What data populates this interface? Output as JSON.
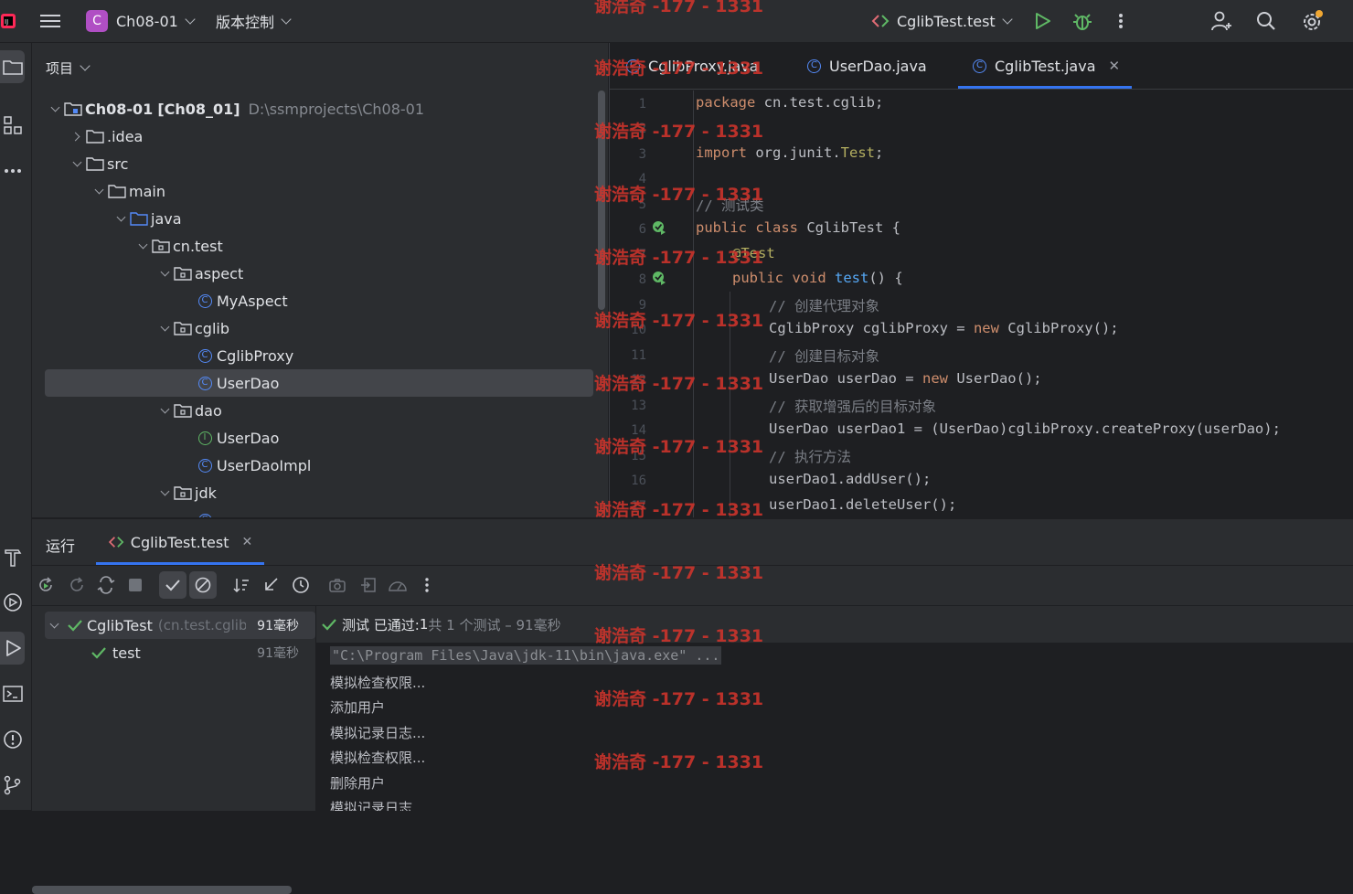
{
  "titlebar": {
    "project_badge": "C",
    "project_name": "Ch08-01",
    "vcs_label": "版本控制",
    "run_config": "CglibTest.test"
  },
  "project_panel": {
    "title": "项目",
    "tree": [
      {
        "label": "Ch08-01",
        "suffix": "[Ch08_01]",
        "path": "D:\\ssmprojects\\Ch08-01",
        "icon": "module-folder-icon"
      },
      {
        "label": ".idea",
        "icon": "folder-icon"
      },
      {
        "label": "src",
        "icon": "folder-icon"
      },
      {
        "label": "main",
        "icon": "folder-icon"
      },
      {
        "label": "java",
        "icon": "source-folder-icon"
      },
      {
        "label": "cn.test",
        "icon": "package-icon"
      },
      {
        "label": "aspect",
        "icon": "package-icon"
      },
      {
        "label": "MyAspect",
        "icon": "class-icon"
      },
      {
        "label": "cglib",
        "icon": "package-icon"
      },
      {
        "label": "CglibProxy",
        "icon": "class-icon"
      },
      {
        "label": "UserDao",
        "icon": "class-icon"
      },
      {
        "label": "dao",
        "icon": "package-icon"
      },
      {
        "label": "UserDao",
        "icon": "interface-icon"
      },
      {
        "label": "UserDaoImpl",
        "icon": "class-icon"
      },
      {
        "label": "jdk",
        "icon": "package-icon"
      }
    ]
  },
  "editor": {
    "tabs": [
      {
        "label": "CglibProxy.java"
      },
      {
        "label": "UserDao.java"
      },
      {
        "label": "CglibTest.java",
        "active": true
      }
    ],
    "line_numbers": [
      "1",
      "2",
      "3",
      "4",
      "5",
      "6",
      "7",
      "8",
      "9",
      "10",
      "11",
      "12",
      "13",
      "14",
      "15",
      "16",
      "17"
    ],
    "code": {
      "l1_kw": "package",
      "l1_rest": " cn.test.cglib;",
      "l3_kw": "import",
      "l3_rest": " org.junit.",
      "l3_ann": "Test",
      "l3_end": ";",
      "l5": "// 测试类",
      "l6_kw": "public class",
      "l6_rest": " CglibTest {",
      "l7": "@Test",
      "l8_kw": "public void",
      "l8_fn": " test",
      "l8_rest": "() {",
      "l9": "// 创建代理对象",
      "l10_a": "CglibProxy cglibProxy = ",
      "l10_kw": "new",
      "l10_b": " CglibProxy();",
      "l11": "// 创建目标对象",
      "l12_a": "UserDao userDao = ",
      "l12_kw": "new",
      "l12_b": " UserDao();",
      "l13": "// 获取增强后的目标对象",
      "l14": "UserDao userDao1 = (UserDao)cglibProxy.createProxy(userDao);",
      "l15": "// 执行方法",
      "l16": "userDao1.addUser();",
      "l17": "userDao1.deleteUser();"
    }
  },
  "run_panel": {
    "title": "运行",
    "tab_label": "CglibTest.test",
    "tree": {
      "root_label": "CglibTest",
      "root_pkg": "(cn.test.cglib",
      "root_time": "91毫秒",
      "child_label": "test",
      "child_time": "91毫秒"
    },
    "status": {
      "prefix": "测试 已通过: ",
      "count": "1",
      "rest": "共 1 个测试 – 91毫秒"
    },
    "console_lines": [
      "\"C:\\Program Files\\Java\\jdk-11\\bin\\java.exe\" ...",
      "模拟检查权限...",
      "添加用户",
      "模拟记录日志...",
      "模拟检查权限...",
      "删除用户",
      "模拟记录日志..."
    ]
  },
  "watermark": "谢浩奇 -177 - 1331",
  "colors": {
    "accent": "#3574f0",
    "success": "#5fb865",
    "watermark": "#d0342c"
  }
}
